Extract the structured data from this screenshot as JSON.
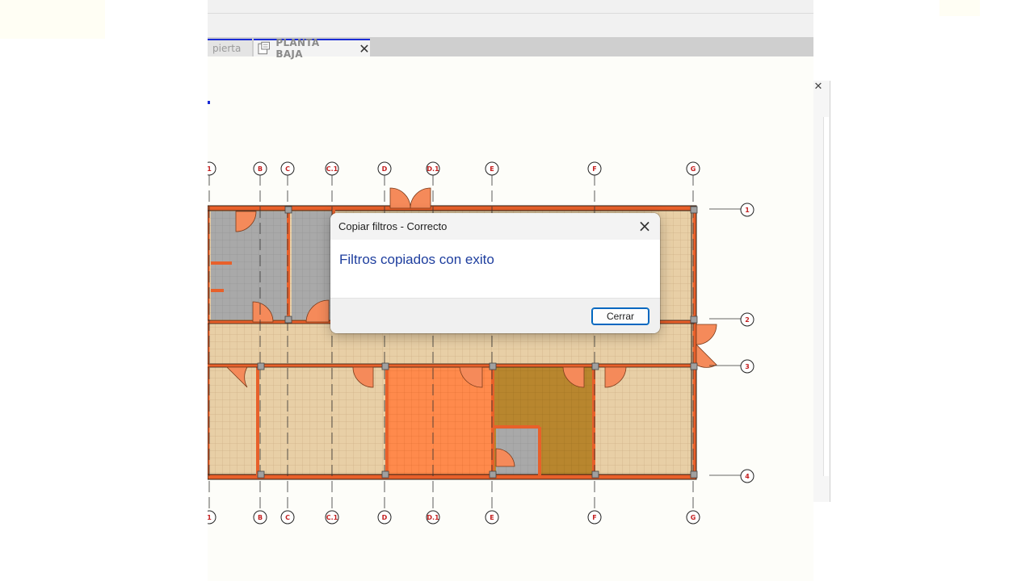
{
  "tabs": [
    {
      "label": "pierta",
      "active": false
    },
    {
      "label": "PLANTA BAJA",
      "active": true
    }
  ],
  "grid": {
    "columns_top": [
      "1",
      "B",
      "C",
      "C.1",
      "D",
      "D.1",
      "E",
      "F",
      "G"
    ],
    "columns_bottom": [
      "1",
      "B",
      "C",
      "C.1",
      "D",
      "D.1",
      "E",
      "F",
      "G"
    ],
    "rows": [
      "1",
      "2",
      "3",
      "4"
    ]
  },
  "dialog": {
    "title": "Copiar filtros - Correcto",
    "message": "Filtros copiados con exito",
    "close_button": "Cerrar"
  },
  "colors": {
    "wall": "#e8602a",
    "floor_tan": "#e8cfa6",
    "floor_gray": "#a9a9a9",
    "floor_orange": "#ff8a4c",
    "floor_brown": "#b8862e",
    "door": "#f58a5a",
    "grid_bubble_text": "#c42020",
    "dialog_message": "#1e3e9e",
    "button_border": "#0067c0",
    "tab_accent": "#1a2bd6"
  }
}
